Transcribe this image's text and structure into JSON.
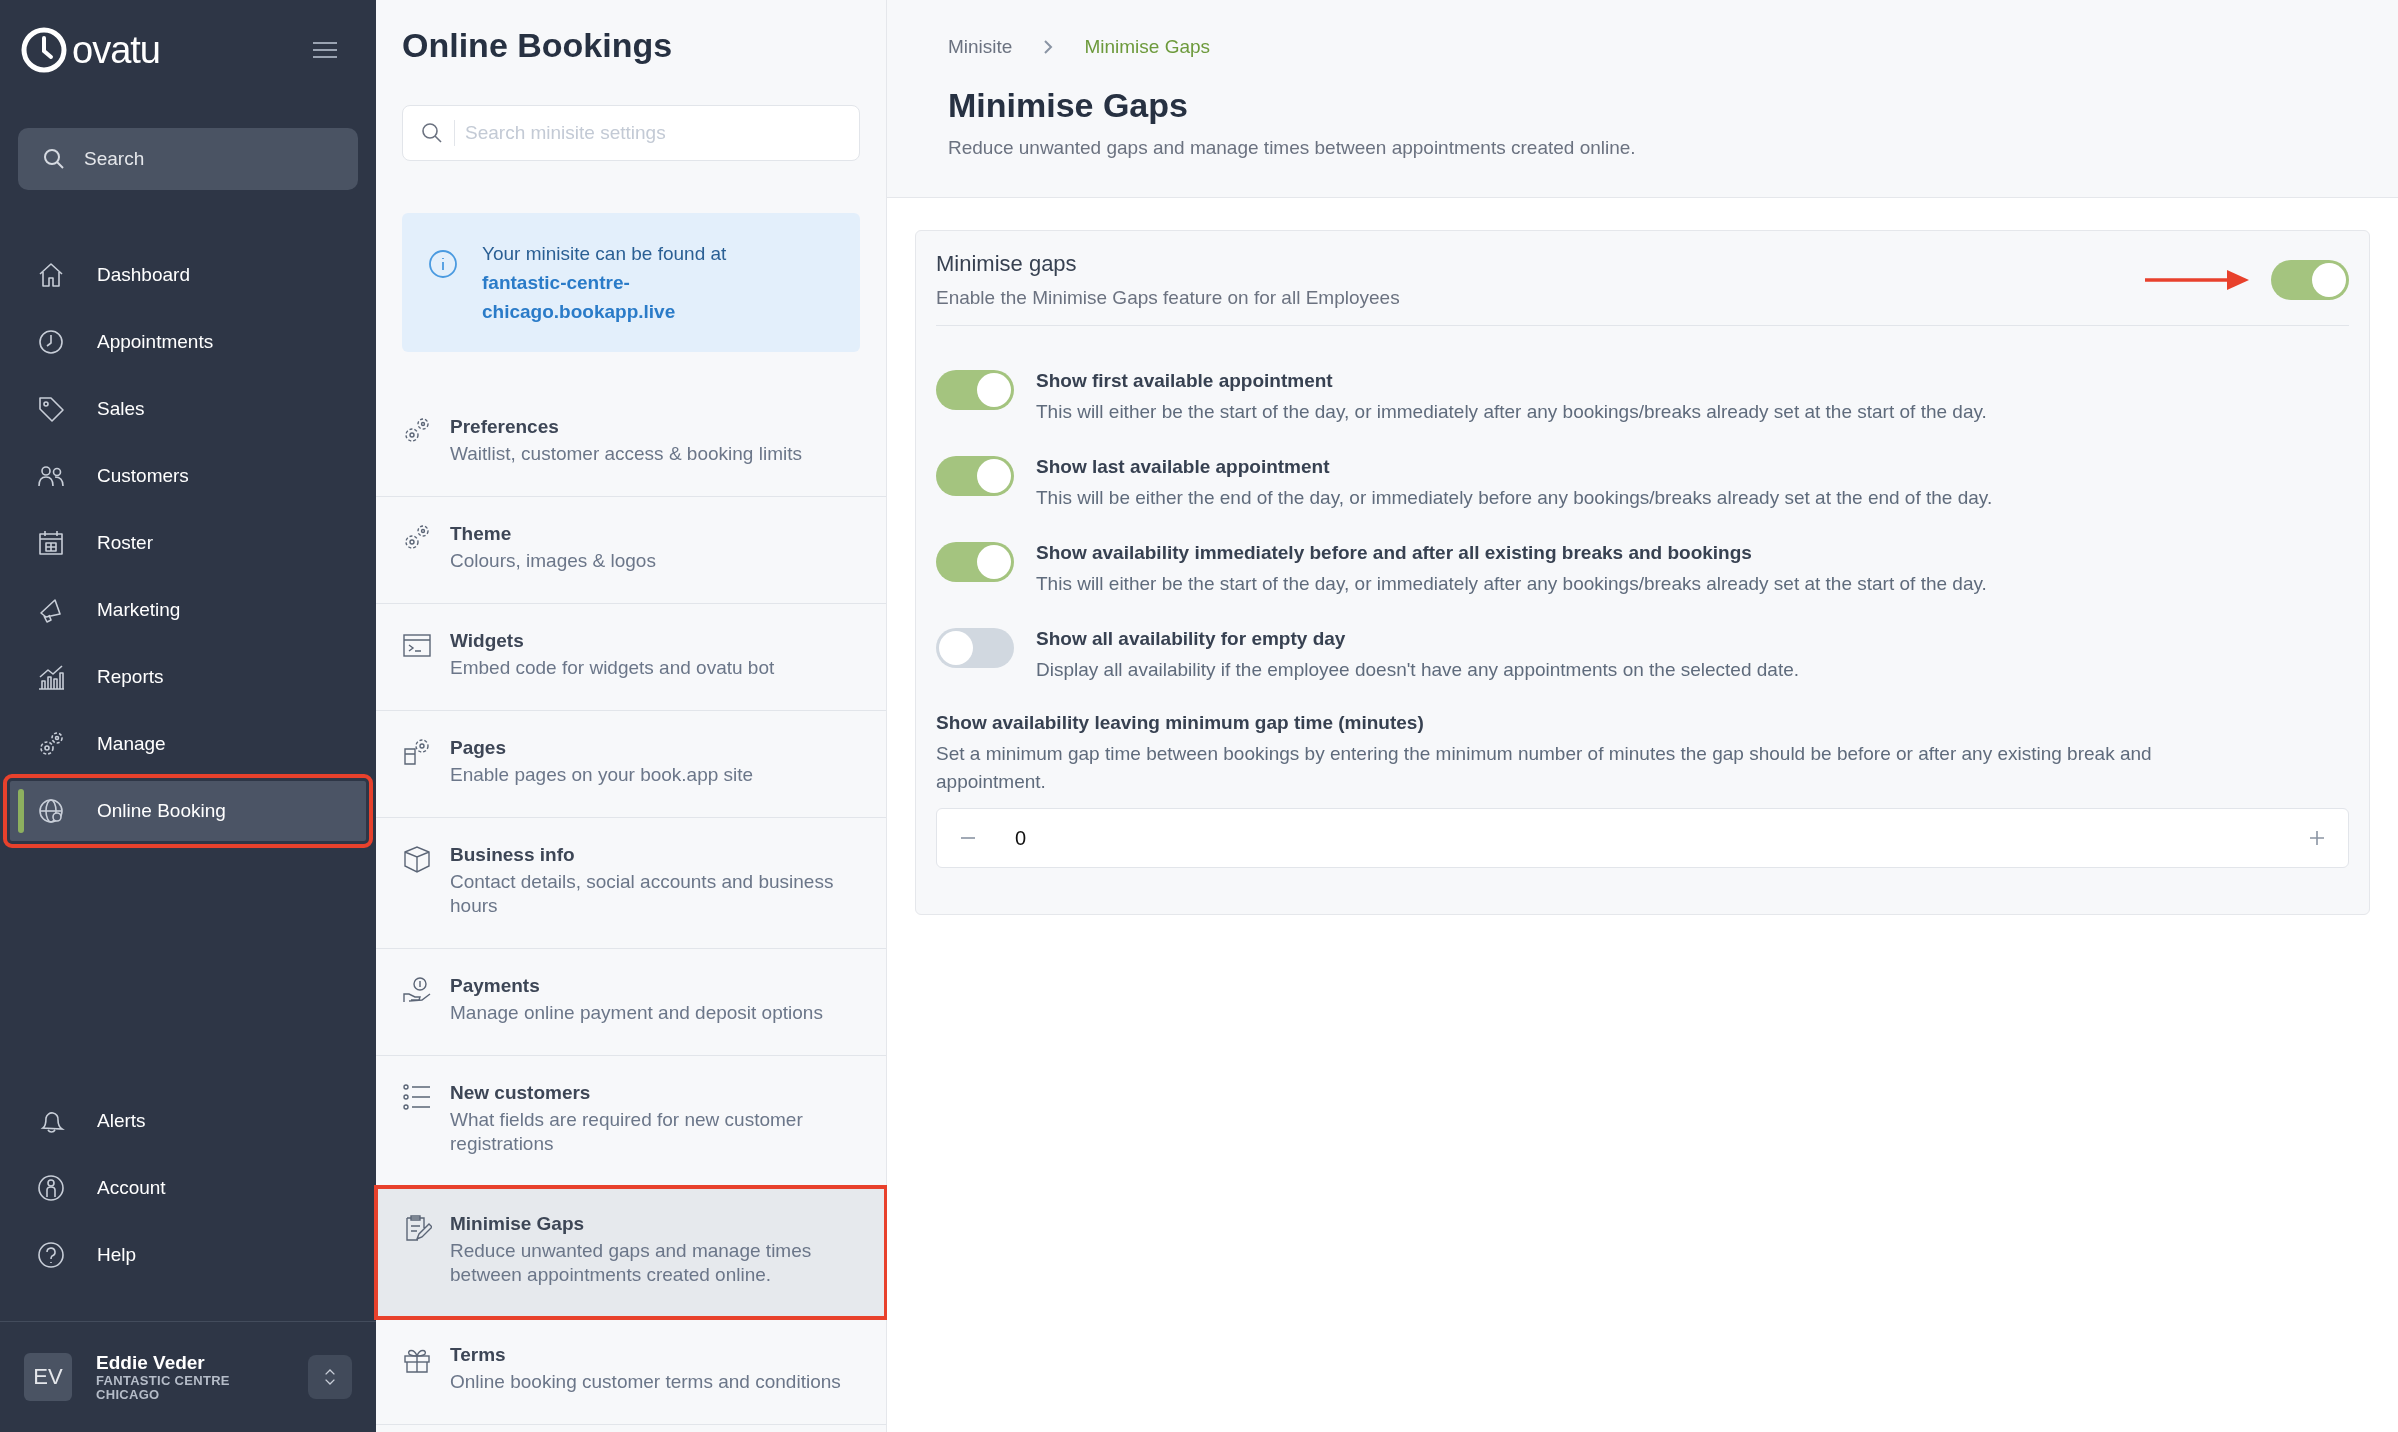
{
  "sidebar": {
    "logo": "ovatu",
    "search": {
      "placeholder": "Search"
    },
    "nav_items": [
      {
        "label": "Dashboard",
        "selected": false,
        "annotated": false
      },
      {
        "label": "Appointments",
        "selected": false,
        "annotated": false
      },
      {
        "label": "Sales",
        "selected": false,
        "annotated": false
      },
      {
        "label": "Customers",
        "selected": false,
        "annotated": false
      },
      {
        "label": "Roster",
        "selected": false,
        "annotated": false
      },
      {
        "label": "Marketing",
        "selected": false,
        "annotated": false
      },
      {
        "label": "Reports",
        "selected": false,
        "annotated": false
      },
      {
        "label": "Manage",
        "selected": false,
        "annotated": false
      },
      {
        "label": "Online Booking",
        "selected": true,
        "annotated": true
      }
    ],
    "bottom_items": [
      {
        "label": "Alerts",
        "selected": false
      },
      {
        "label": "Account",
        "selected": false
      },
      {
        "label": "Help",
        "selected": false
      }
    ],
    "user": {
      "initials": "EV",
      "name": "Eddie Veder",
      "business": "FANTASTIC CENTRE CHICAGO"
    }
  },
  "settings_panel": {
    "title": "Online Bookings",
    "search": {
      "placeholder": "Search minisite settings"
    },
    "info": {
      "text": "Your minisite can be found at",
      "link": "fantastic-centre-chicago.bookapp.live"
    },
    "items": [
      {
        "title": "Preferences",
        "description": "Waitlist, customer access & booking limits",
        "selected": false,
        "annotated": false
      },
      {
        "title": "Theme",
        "description": "Colours, images & logos",
        "selected": false,
        "annotated": false
      },
      {
        "title": "Widgets",
        "description": "Embed code for widgets and ovatu bot",
        "selected": false,
        "annotated": false
      },
      {
        "title": "Pages",
        "description": "Enable pages on your book.app site",
        "selected": false,
        "annotated": false
      },
      {
        "title": "Business info",
        "description": "Contact details, social accounts and business hours",
        "selected": false,
        "annotated": false
      },
      {
        "title": "Payments",
        "description": "Manage online payment and deposit options",
        "selected": false,
        "annotated": false
      },
      {
        "title": "New customers",
        "description": "What fields are required for new customer registrations",
        "selected": false,
        "annotated": false
      },
      {
        "title": "Minimise Gaps",
        "description": "Reduce unwanted gaps and manage times between appointments created online.",
        "selected": true,
        "annotated": true
      },
      {
        "title": "Terms",
        "description": "Online booking customer terms and conditions",
        "selected": false,
        "annotated": false
      }
    ]
  },
  "main": {
    "breadcrumb": [
      {
        "label": "Minisite",
        "current": false
      },
      {
        "label": "Minimise Gaps",
        "current": true
      }
    ],
    "title": "Minimise Gaps",
    "subtitle": "Reduce unwanted gaps and manage times between appointments created online.",
    "card": {
      "title": "Minimise gaps",
      "description": "Enable the Minimise Gaps feature on for all Employees",
      "on": true,
      "arrow": true,
      "options": [
        {
          "label": "Show first available appointment",
          "description": "This will either be the start of the day, or immediately after any bookings/breaks already set at the start of the day.",
          "on": true
        },
        {
          "label": "Show last available appointment",
          "description": "This will be either the end of the day, or immediately before any bookings/breaks already set at the end of the day.",
          "on": true
        },
        {
          "label": "Show availability immediately before and after all existing breaks and bookings",
          "description": "This will either be the start of the day, or immediately after any bookings/breaks already set at the start of the day.",
          "on": true
        },
        {
          "label": "Show all availability for empty day",
          "description": "Display all availability if the employee doesn't have any appointments on the selected date.",
          "on": false
        }
      ],
      "gap": {
        "label": "Show availability leaving minimum gap time (minutes)",
        "description": "Set a minimum gap time between bookings by entering the minimum number of minutes the gap should be before or after any existing break and appointment.",
        "value": "0"
      }
    }
  }
}
